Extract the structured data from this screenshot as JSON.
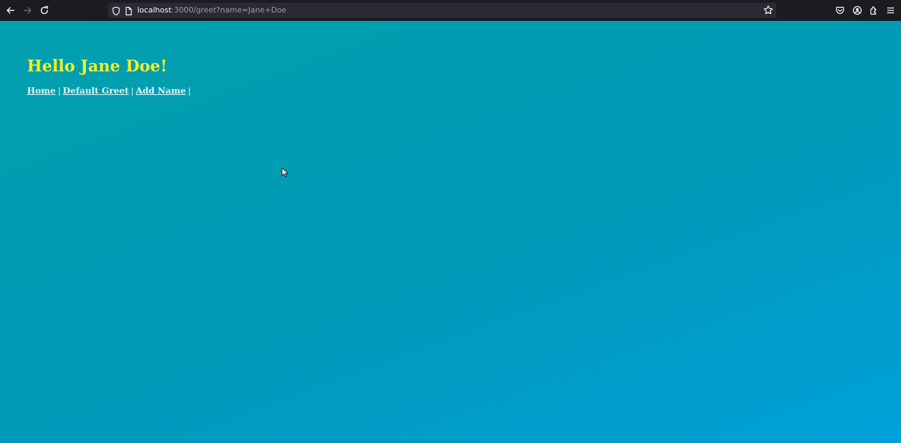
{
  "browser": {
    "url_host": "localhost",
    "url_path": ":3000/greet?name=Jane+Doe",
    "icons": {
      "back": "back-arrow-icon",
      "forward": "forward-arrow-icon",
      "reload": "reload-icon",
      "shield": "tracking-protection-shield-icon",
      "page": "page-icon",
      "bookmark": "bookmark-star-icon",
      "pocket": "pocket-icon",
      "account": "account-icon",
      "extensions": "extensions-icon",
      "menu": "hamburger-menu-icon"
    }
  },
  "page": {
    "title": "Hello Jane Doe!",
    "links": [
      {
        "label": "Home"
      },
      {
        "label": "Default Greet"
      },
      {
        "label": "Add Name"
      }
    ],
    "separator": "|"
  },
  "colors": {
    "title": "#eef02a",
    "background_start": "#01a0ad",
    "background_end": "#00a1d9",
    "link": "#e8f6fb"
  }
}
